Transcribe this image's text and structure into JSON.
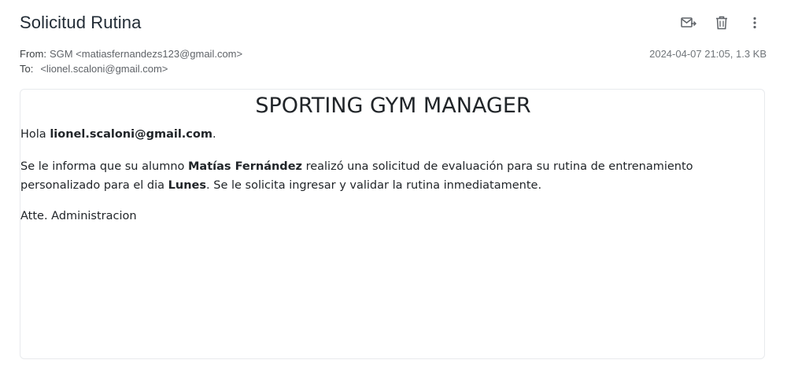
{
  "email": {
    "subject": "Solicitud Rutina",
    "from_label": "From:",
    "from_value": "SGM <matiasfernandezs123@gmail.com>",
    "to_label": "To:",
    "to_value": "<lionel.scaloni@gmail.com>",
    "date_size": "2024-04-07 21:05, 1.3 KB"
  },
  "toolbar": {
    "icons": [
      "forward-mail-icon",
      "trash-icon",
      "more-vertical-icon"
    ]
  },
  "content": {
    "brand": "SPORTING GYM MANAGER",
    "greeting_prefix": "Hola ",
    "greeting_email": "lionel.scaloni@gmail.com",
    "greeting_suffix": ".",
    "p2_a": "Se le informa que su alumno ",
    "p2_student": "Matías Fernández",
    "p2_b": " realizó una solicitud de evaluación para su rutina de entrenamiento personalizado para el dia ",
    "p2_day": "Lunes",
    "p2_c": ". Se le solicita ingresar y validar la rutina inmediatamente.",
    "signoff": "Atte. Administracion"
  }
}
